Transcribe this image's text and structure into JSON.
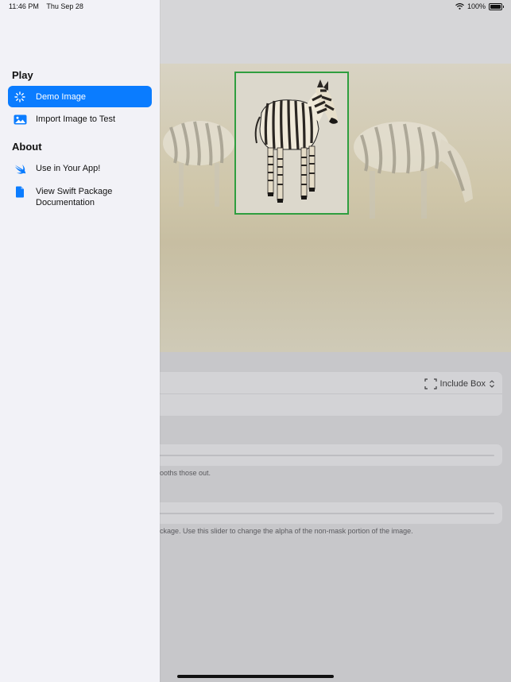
{
  "status_bar": {
    "time": "11:46 PM",
    "date": "Thu Sep 28",
    "battery": "100%"
  },
  "sidebar": {
    "sections": [
      {
        "title": "Play",
        "items": [
          {
            "label": "Demo Image",
            "icon": "sparkle-icon",
            "selected": true
          },
          {
            "label": "Import Image to Test",
            "icon": "photo-icon",
            "selected": false
          }
        ]
      },
      {
        "title": "About",
        "items": [
          {
            "label": "Use in Your App!",
            "icon": "swift-icon",
            "selected": false
          },
          {
            "label": "View Swift Package Documentation",
            "icon": "document-icon",
            "selected": false
          }
        ]
      }
    ]
  },
  "main": {
    "include_box_label": "Include Box",
    "footnote_1": "ooths those out.",
    "footnote_2": "ckage. Use this slider to change the alpha of the non-mask portion of the image."
  },
  "colors": {
    "accent": "#0a7cff",
    "detection_box": "#2f9e3f",
    "sidebar_bg": "#f2f2f7"
  }
}
